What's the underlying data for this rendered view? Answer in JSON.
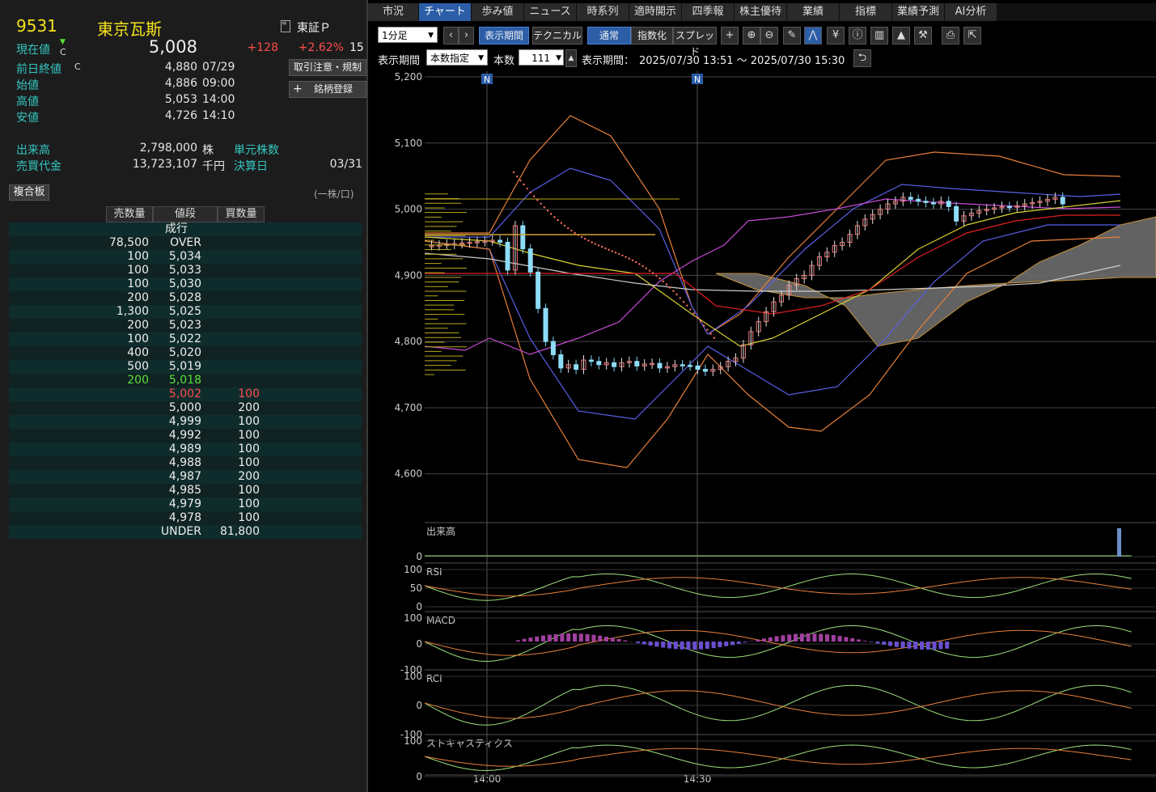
{
  "stock": {
    "code": "9531",
    "name": "東京瓦斯",
    "market": "東証Ｐ",
    "current_label": "現在値",
    "current_mark": "C",
    "current_price": "5,008",
    "change": "+128",
    "change_pct": "+2.62%",
    "change_time": "15",
    "prev_close_label": "前日終値",
    "prev_close_mark": "C",
    "prev_close": "4,880",
    "prev_close_date": "07/29",
    "open_label": "始値",
    "open": "4,886",
    "open_time": "09:00",
    "high_label": "高値",
    "high": "5,053",
    "high_time": "14:00",
    "low_label": "安値",
    "low": "4,726",
    "low_time": "14:10",
    "volume_label": "出来高",
    "volume": "2,798,000",
    "volume_unit": "株",
    "unit_shares_label": "単元株数",
    "turnover_label": "売買代金",
    "turnover": "13,723,107",
    "turnover_unit": "千円",
    "settlement_label": "決算日",
    "settlement": "03/31"
  },
  "buttons": {
    "caution": "取引注意・規制",
    "register": "銘柄登録",
    "register_icon": "+"
  },
  "book": {
    "tab": "複合板",
    "unit_note": "(一株/口)",
    "headers": {
      "sell": "売数量",
      "price": "値段",
      "buy": "買数量"
    },
    "rows": [
      {
        "sell": "",
        "price": "成行",
        "buy": "",
        "kind": "market"
      },
      {
        "sell": "78,500",
        "price": "OVER",
        "buy": "",
        "kind": "ask"
      },
      {
        "sell": "100",
        "price": "5,034",
        "buy": "",
        "kind": "ask"
      },
      {
        "sell": "100",
        "price": "5,033",
        "buy": "",
        "kind": "ask"
      },
      {
        "sell": "100",
        "price": "5,030",
        "buy": "",
        "kind": "ask"
      },
      {
        "sell": "200",
        "price": "5,028",
        "buy": "",
        "kind": "ask"
      },
      {
        "sell": "1,300",
        "price": "5,025",
        "buy": "",
        "kind": "ask"
      },
      {
        "sell": "200",
        "price": "5,023",
        "buy": "",
        "kind": "ask"
      },
      {
        "sell": "100",
        "price": "5,022",
        "buy": "",
        "kind": "ask"
      },
      {
        "sell": "400",
        "price": "5,020",
        "buy": "",
        "kind": "ask"
      },
      {
        "sell": "500",
        "price": "5,019",
        "buy": "",
        "kind": "ask"
      },
      {
        "sell": "200",
        "price": "5,018",
        "buy": "",
        "kind": "best_ask"
      },
      {
        "sell": "",
        "price": "5,002",
        "buy": "100",
        "kind": "best_bid"
      },
      {
        "sell": "",
        "price": "5,000",
        "buy": "200",
        "kind": "bid"
      },
      {
        "sell": "",
        "price": "4,999",
        "buy": "100",
        "kind": "bid"
      },
      {
        "sell": "",
        "price": "4,992",
        "buy": "100",
        "kind": "bid"
      },
      {
        "sell": "",
        "price": "4,989",
        "buy": "100",
        "kind": "bid"
      },
      {
        "sell": "",
        "price": "4,988",
        "buy": "100",
        "kind": "bid"
      },
      {
        "sell": "",
        "price": "4,987",
        "buy": "200",
        "kind": "bid"
      },
      {
        "sell": "",
        "price": "4,985",
        "buy": "100",
        "kind": "bid"
      },
      {
        "sell": "",
        "price": "4,979",
        "buy": "100",
        "kind": "bid"
      },
      {
        "sell": "",
        "price": "4,978",
        "buy": "100",
        "kind": "bid"
      },
      {
        "sell": "",
        "price": "UNDER",
        "buy": "81,800",
        "kind": "bid"
      }
    ]
  },
  "tabs": [
    "市況",
    "チャート",
    "歩み値",
    "ニュース",
    "時系列",
    "適時開示",
    "四季報",
    "株主優待",
    "業績",
    "指標",
    "業績予測",
    "AI分析"
  ],
  "active_tab": "チャート",
  "toolbar": {
    "interval": "1分足",
    "period_btn": "表示期間",
    "technical_btn": "テクニカル",
    "normal_btn": "通常",
    "index_btn": "指数化",
    "spread_btn": "スプレッド",
    "prev_icon": "chevron-left-icon",
    "next_icon": "chevron-right-icon",
    "icons": [
      "crosshair-icon",
      "zoom-in-icon",
      "zoom-out-icon",
      "pencil-icon",
      "trend-icon",
      "yen-icon",
      "info-icon",
      "my-chart-icon",
      "volume-profile-icon",
      "wrench-icon",
      "print-icon",
      "export-icon"
    ]
  },
  "period_bar": {
    "label": "表示期間",
    "mode": "本数指定",
    "count_label": "本数",
    "count": "111",
    "range_label": "表示期間：",
    "range": "2025/07/30 13:51 ～ 2025/07/30 15:30"
  },
  "chart_data": {
    "type": "candlestick",
    "price_ticks": [
      "5,200",
      "5,100",
      "5,000",
      "4,900",
      "4,800",
      "4,700",
      "4,600"
    ],
    "ylim": [
      4530,
      5200
    ],
    "x_ticks": [
      "14:00",
      "14:30"
    ],
    "news_marker": "N",
    "subpanels": [
      {
        "name": "出来高",
        "ticks": [
          "0"
        ]
      },
      {
        "name": "RSI",
        "ticks": [
          "100",
          "50",
          "0"
        ]
      },
      {
        "name": "MACD",
        "ticks": [
          "100",
          "0",
          "-100"
        ]
      },
      {
        "name": "RCI",
        "ticks": [
          "100",
          "0",
          "-100"
        ]
      },
      {
        "name": "ストキャスティクス",
        "ticks": [
          "100",
          "0"
        ]
      }
    ],
    "close": [
      4945,
      4946,
      4947,
      4948,
      4949,
      4950,
      4951,
      4952,
      4953,
      4950,
      4908,
      4975,
      4940,
      4905,
      4850,
      4800,
      4780,
      4760,
      4765,
      4758,
      4772,
      4770,
      4765,
      4768,
      4762,
      4768,
      4770,
      4763,
      4766,
      4767,
      4760,
      4762,
      4765,
      4764,
      4763,
      4758,
      4755,
      4758,
      4762,
      4770,
      4775,
      4795,
      4815,
      4830,
      4845,
      4860,
      4870,
      4885,
      4895,
      4900,
      4915,
      4928,
      4935,
      4945,
      4950,
      4962,
      4975,
      4985,
      4992,
      5000,
      5008,
      5012,
      5018,
      5015,
      5012,
      5010,
      5008,
      5012,
      5004,
      4982,
      4990,
      4994,
      4998,
      5000,
      5002,
      5004,
      5003,
      5005,
      5008,
      5010,
      5012,
      5015,
      5018,
      5008
    ],
    "volume_spike": 1
  }
}
